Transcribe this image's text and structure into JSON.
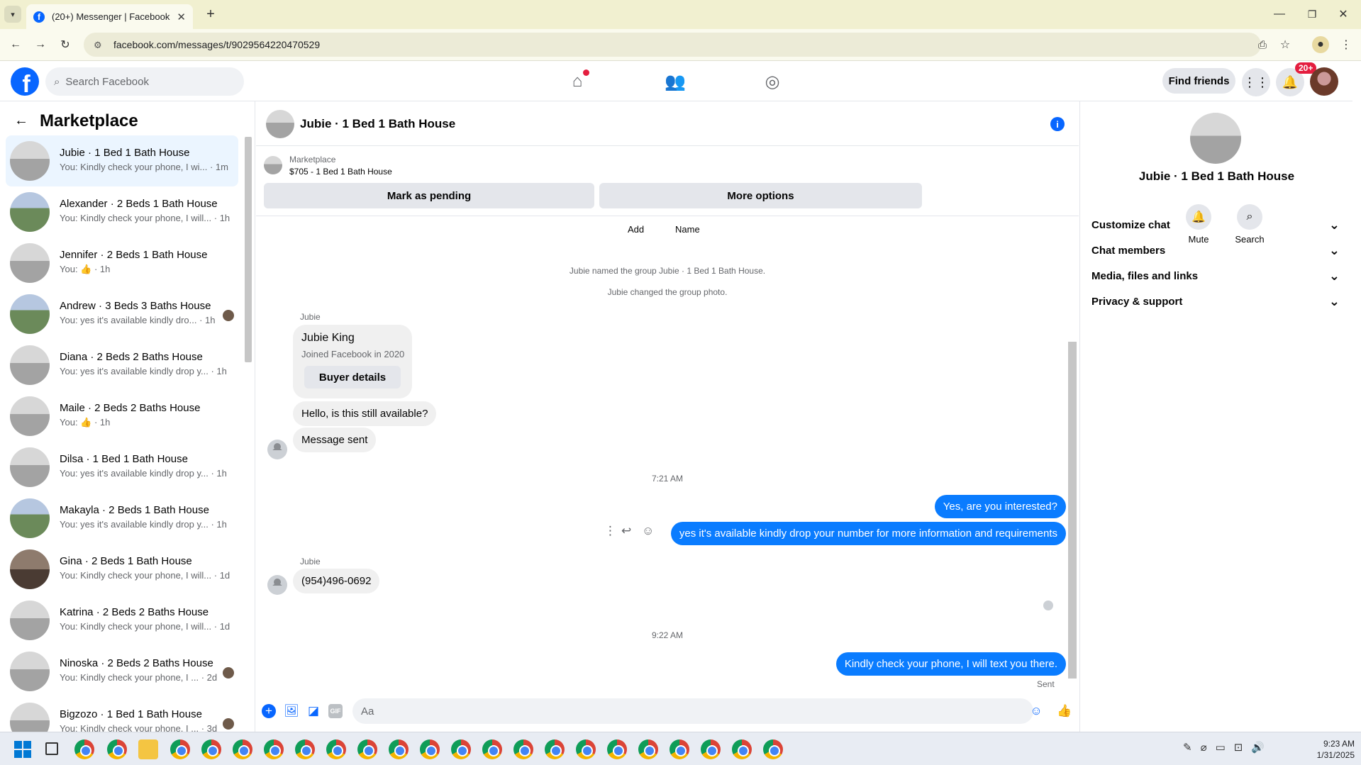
{
  "browser": {
    "tab_title": "(20+) Messenger | Facebook",
    "url": "facebook.com/messages/t/9029564220470529"
  },
  "fb_header": {
    "search_placeholder": "Search Facebook",
    "find_friends_label": "Find friends",
    "notification_badge": "20+"
  },
  "sidebar": {
    "title": "Marketplace",
    "conversations": [
      {
        "name": "Jubie · 1 Bed 1 Bath House",
        "preview": "You: Kindly check your phone, I wi... · 1m",
        "active": true
      },
      {
        "name": "Alexander · 2 Beds 1 Bath House",
        "preview": "You: Kindly check your phone, I will... · 1h"
      },
      {
        "name": "Jennifer · 2 Beds 1 Bath House",
        "preview": "You: 👍 · 1h"
      },
      {
        "name": "Andrew · 3 Beds 3 Baths House",
        "preview": "You: yes it's available kindly dro... · 1h"
      },
      {
        "name": "Diana · 2 Beds 2 Baths House",
        "preview": "You: yes it's available kindly drop y... · 1h"
      },
      {
        "name": "Maile · 2 Beds 2 Baths House",
        "preview": "You: 👍 · 1h"
      },
      {
        "name": "Dilsa · 1 Bed 1 Bath House",
        "preview": "You: yes it's available kindly drop y... · 1h"
      },
      {
        "name": "Makayla · 2 Beds 1 Bath House",
        "preview": "You: yes it's available kindly drop y... · 1h"
      },
      {
        "name": "Gina · 2 Beds 1 Bath House",
        "preview": "You: Kindly check your phone, I will... · 1d"
      },
      {
        "name": "Katrina · 2 Beds 2 Baths House",
        "preview": "You: Kindly check your phone, I will... · 1d"
      },
      {
        "name": "Ninoska · 2 Beds 2 Baths House",
        "preview": "You: Kindly check your phone, I ... · 2d"
      },
      {
        "name": "Bigzozo · 1 Bed 1 Bath House",
        "preview": "You: Kindly check your phone, I ... · 3d"
      }
    ]
  },
  "chat": {
    "title": "Jubie · 1 Bed 1 Bath House",
    "marketplace_label": "Marketplace",
    "listing": "$705 - 1 Bed 1 Bath House",
    "mark_pending_label": "Mark as pending",
    "more_options_label": "More options",
    "add_label": "Add",
    "name_label": "Name",
    "sys1": "Jubie named the group Jubie · 1 Bed 1 Bath House.",
    "sys2": "Jubie changed the group photo.",
    "sender1": "Jubie",
    "buyer_name": "Jubie King",
    "buyer_joined": "Joined Facebook in 2020",
    "buyer_details_label": "Buyer details",
    "msg_in_1": "Hello, is this still available?",
    "msg_in_2": "Message sent",
    "time1": "7:21 AM",
    "msg_out_1": "Yes, are you interested?",
    "msg_out_2": "yes it's available kindly drop your number for more information and requirements",
    "sender2": "Jubie",
    "msg_in_3": "(954)496-0692",
    "time2": "9:22 AM",
    "msg_out_3": "Kindly check your phone, I will text you there.",
    "sent_label": "Sent",
    "composer_placeholder": "Aa"
  },
  "right_panel": {
    "name": "Jubie · 1 Bed 1 Bath House",
    "mute_label": "Mute",
    "search_label": "Search",
    "sections": [
      "Customize chat",
      "Chat members",
      "Media, files and links",
      "Privacy & support"
    ]
  },
  "taskbar": {
    "time": "9:23 AM",
    "date": "1/31/2025"
  },
  "colors": {
    "brand_blue": "#0866ff",
    "outgoing_bubble": "#0a7cff",
    "active_conversation": "#ebf5ff"
  }
}
